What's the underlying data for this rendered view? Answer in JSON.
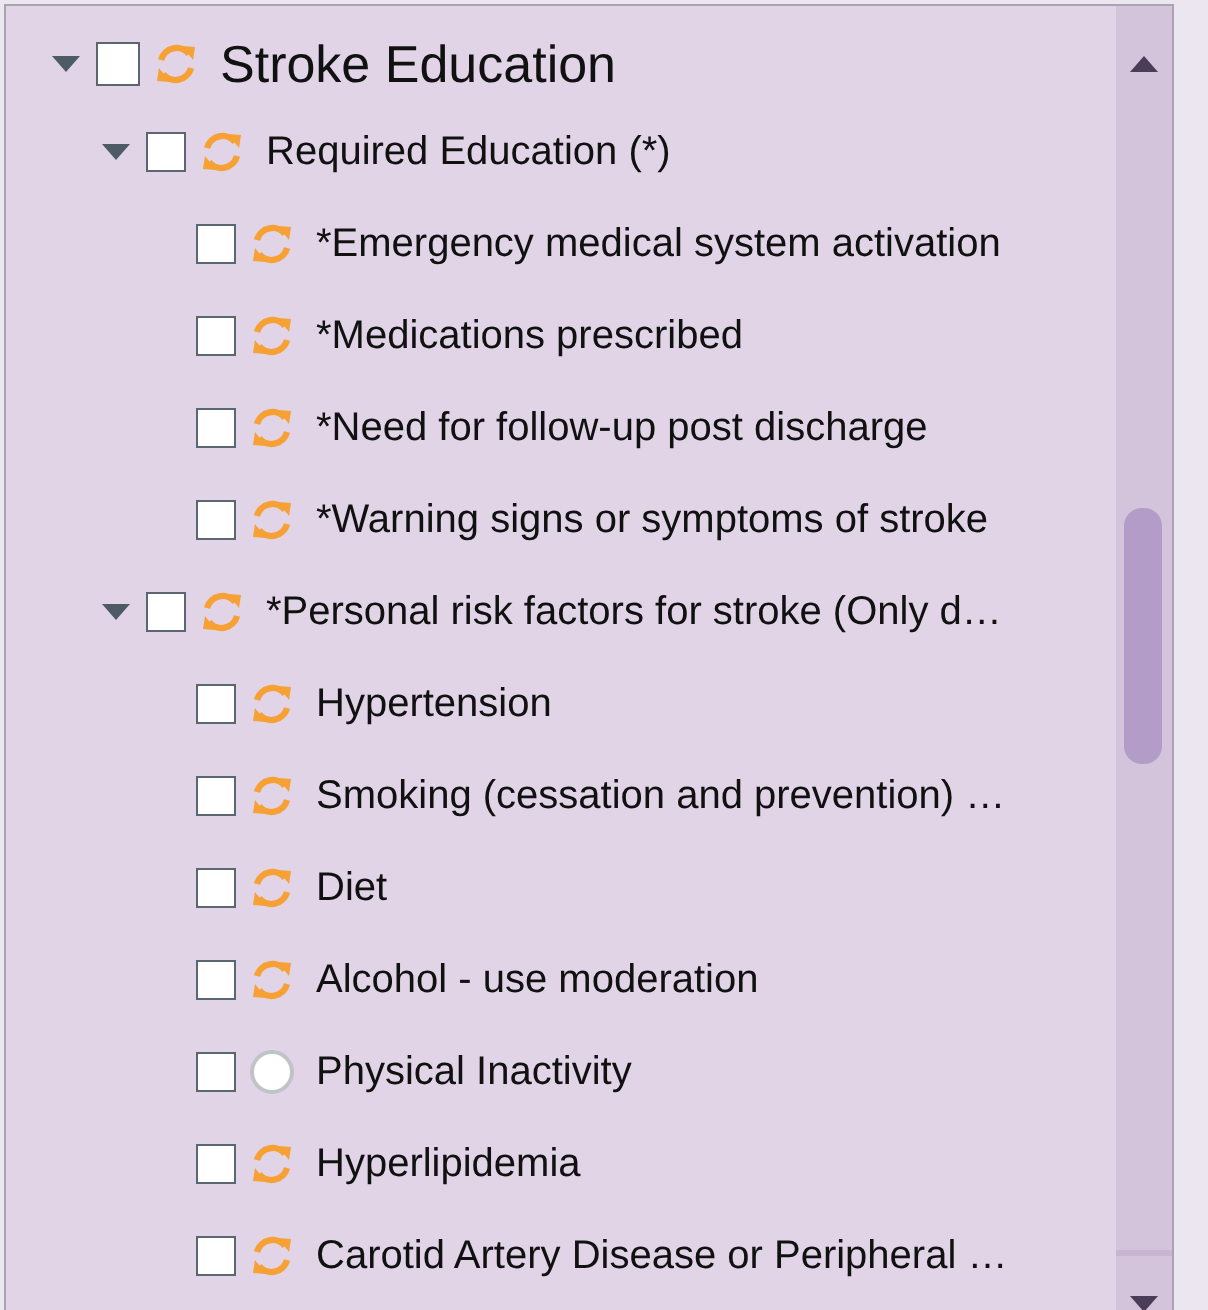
{
  "tree": [
    {
      "label": "Stroke Education",
      "expanded": true,
      "checked": false,
      "kind": "in_progress",
      "children": [
        {
          "label": "Required Education (*)",
          "expanded": true,
          "checked": false,
          "kind": "in_progress",
          "children": [
            {
              "label": "*Emergency medical system activation",
              "checked": false,
              "kind": "in_progress"
            },
            {
              "label": "*Medications prescribed",
              "checked": false,
              "kind": "in_progress"
            },
            {
              "label": "*Need for follow-up post discharge",
              "checked": false,
              "kind": "in_progress"
            },
            {
              "label": "*Warning signs or symptoms of stroke",
              "checked": false,
              "kind": "in_progress"
            }
          ]
        },
        {
          "label": "*Personal risk factors for stroke (Only d…",
          "expanded": true,
          "checked": false,
          "kind": "in_progress",
          "children": [
            {
              "label": "Hypertension",
              "checked": false,
              "kind": "in_progress"
            },
            {
              "label": "Smoking (cessation and prevention) …",
              "checked": false,
              "kind": "in_progress"
            },
            {
              "label": "Diet",
              "checked": false,
              "kind": "in_progress"
            },
            {
              "label": "Alcohol - use moderation",
              "checked": false,
              "kind": "in_progress"
            },
            {
              "label": "Physical Inactivity",
              "checked": false,
              "kind": "not_started"
            },
            {
              "label": "Hyperlipidemia",
              "checked": false,
              "kind": "in_progress"
            },
            {
              "label": "Carotid Artery Disease or Peripheral …",
              "checked": false,
              "kind": "in_progress"
            }
          ]
        }
      ]
    }
  ]
}
